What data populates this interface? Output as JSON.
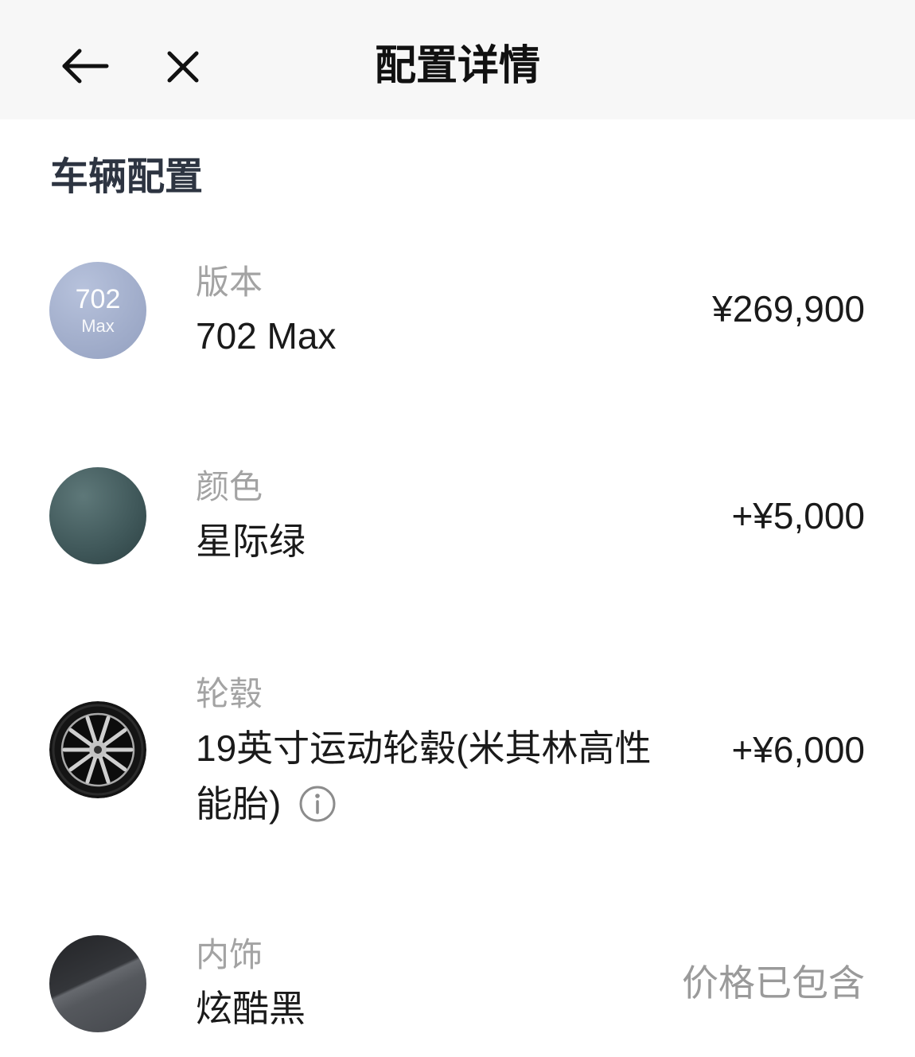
{
  "header": {
    "title": "配置详情",
    "back_icon": "arrow-left-icon",
    "close_icon": "close-icon"
  },
  "section": {
    "title": "车辆配置"
  },
  "items": [
    {
      "label": "版本",
      "value": "702 Max",
      "price": "¥269,900",
      "badge": {
        "main": "702",
        "sub": "Max"
      }
    },
    {
      "label": "颜色",
      "value": "星际绿",
      "price": "+¥5,000",
      "swatch_color": "#3f5759"
    },
    {
      "label": "轮毂",
      "value": "19英寸运动轮毂(米其林高性能胎)",
      "price": "+¥6,000",
      "thumbnail_icon": "wheel-icon",
      "info_icon": "info-icon"
    },
    {
      "label": "内饰",
      "value": "炫酷黑",
      "price": "价格已包含",
      "swatch_color": "#3a3c40"
    }
  ],
  "colors": {
    "header_background": "#f7f7f7",
    "label_text": "#a3a3a3",
    "primary_text": "#1a1a1a",
    "section_title": "#2d3441",
    "muted_price": "#9a9a9a"
  }
}
